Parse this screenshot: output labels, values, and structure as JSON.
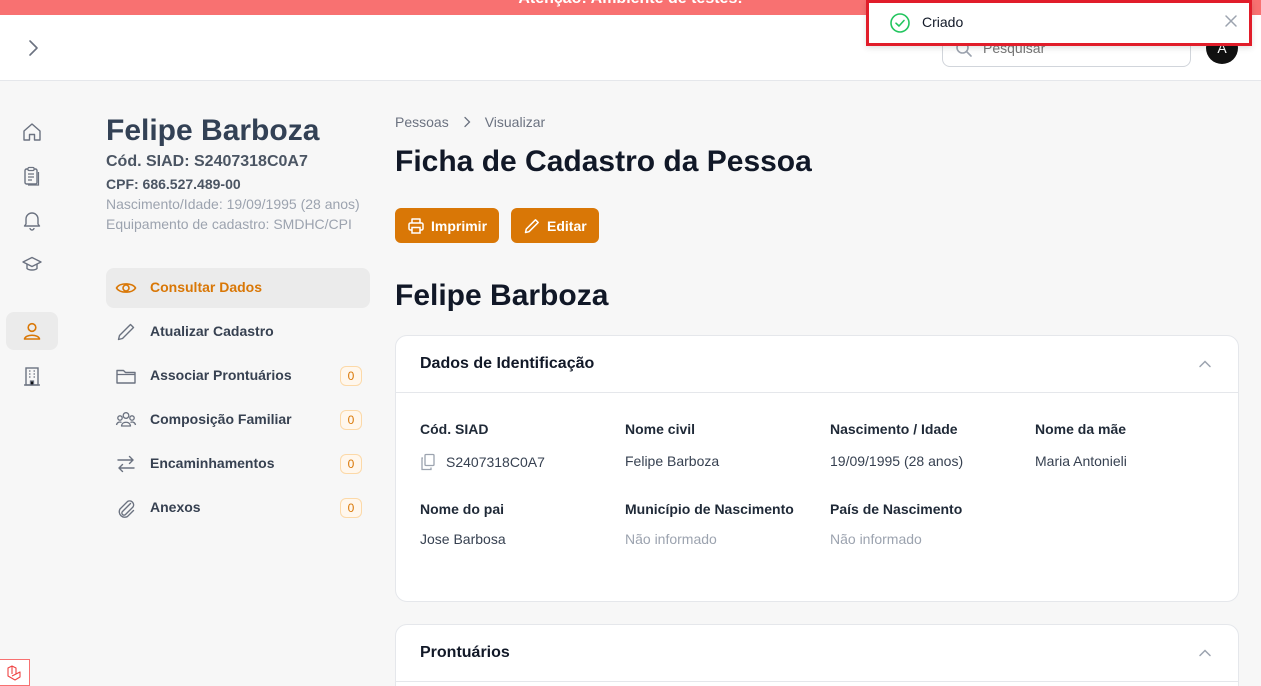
{
  "banner": {
    "text": "Atenção: Ambiente de testes!"
  },
  "toast": {
    "message": "Criado"
  },
  "header": {
    "search_placeholder": "Pesquisar",
    "avatar_initial": "A"
  },
  "rail": {
    "items": [
      {
        "icon": "home-icon"
      },
      {
        "icon": "clipboard-icon"
      },
      {
        "icon": "bell-icon"
      },
      {
        "icon": "graduation-cap-icon"
      },
      {
        "icon": "user-icon",
        "active": true
      },
      {
        "icon": "building-icon"
      }
    ]
  },
  "profile": {
    "name": "Felipe Barboza",
    "siad": "Cód. SIAD: S2407318C0A7",
    "cpf": "CPF: 686.527.489-00",
    "birth": "Nascimento/Idade: 19/09/1995 (28 anos)",
    "equipment": "Equipamento de cadastro: SMDHC/CPI"
  },
  "menu": {
    "items": [
      {
        "label": "Consultar Dados",
        "icon": "eye-icon",
        "active": true
      },
      {
        "label": "Atualizar Cadastro",
        "icon": "pencil-icon"
      },
      {
        "label": "Associar Prontuários",
        "icon": "folder-icon",
        "badge": "0"
      },
      {
        "label": "Composição Familiar",
        "icon": "users-icon",
        "badge": "0"
      },
      {
        "label": "Encaminhamentos",
        "icon": "arrows-swap-icon",
        "badge": "0"
      },
      {
        "label": "Anexos",
        "icon": "paperclip-icon",
        "badge": "0"
      }
    ]
  },
  "breadcrumb": {
    "items": [
      "Pessoas",
      "Visualizar"
    ]
  },
  "page": {
    "title": "Ficha de Cadastro da Pessoa",
    "print_label": "Imprimir",
    "edit_label": "Editar",
    "person_name": "Felipe Barboza"
  },
  "identification": {
    "title": "Dados de Identificação",
    "fields": [
      {
        "label": "Cód. SIAD",
        "value": "S2407318C0A7"
      },
      {
        "label": "Nome civil",
        "value": "Felipe Barboza"
      },
      {
        "label": "Nascimento / Idade",
        "value": "19/09/1995 (28 anos)"
      },
      {
        "label": "Nome da mãe",
        "value": "Maria Antonieli"
      },
      {
        "label": "Nome do pai",
        "value": "Jose Barbosa"
      },
      {
        "label": "Município de Nascimento",
        "value": "Não informado"
      },
      {
        "label": "País de Nascimento",
        "value": "Não informado"
      }
    ]
  },
  "records": {
    "title": "Prontuários"
  },
  "colors": {
    "accent": "#d97706",
    "banner": "#f87171",
    "toast_border": "#e11d2a",
    "success": "#22c55e"
  }
}
